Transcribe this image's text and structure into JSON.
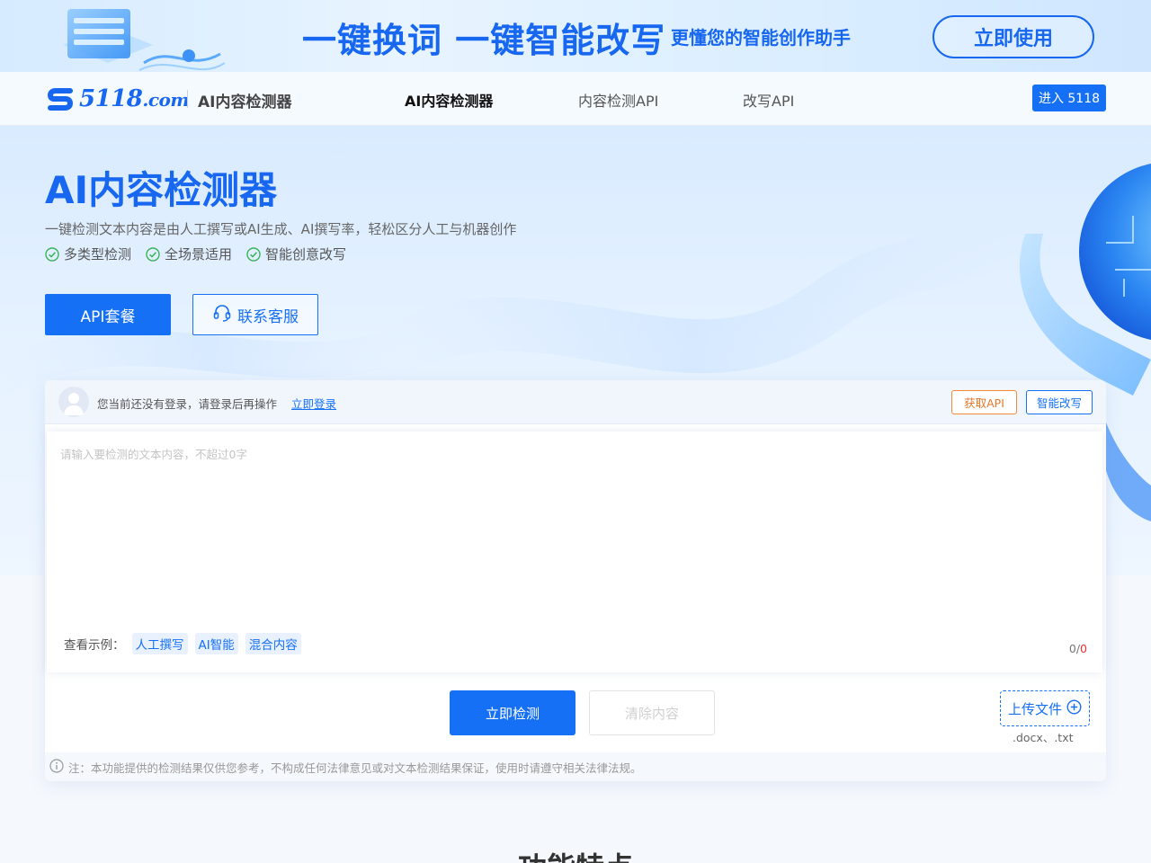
{
  "banner": {
    "title": "一键换词 一键智能改写",
    "subtitle": "更懂您的智能创作助手",
    "cta": "立即使用"
  },
  "nav": {
    "logo_text": "5118",
    "logo_domain": ".com",
    "product_name": "AI内容检测器",
    "links": [
      "AI内容检测器",
      "内容检测API",
      "改写API"
    ],
    "active_link": "AI内容检测器",
    "enter_button": "进入 5118"
  },
  "hero": {
    "title": "AI内容检测器",
    "description": "一键检测文本内容是由人工撰写或AI生成、AI撰写率，轻松区分人工与机器创作",
    "features": [
      "多类型检测",
      "全场景适用",
      "智能创意改写"
    ],
    "primary_button": "API套餐",
    "secondary_button": "联系客服"
  },
  "detector": {
    "login_tip": "您当前还没有登录，请登录后再操作",
    "login_link": "立即登录",
    "get_api_button": "获取API",
    "rewrite_button": "智能改写",
    "input_placeholder": "请输入要检测的文本内容，不超过0字",
    "examples_label": "查看示例：",
    "examples": [
      "人工撰写",
      "AI智能",
      "混合内容"
    ],
    "count_current": "0/",
    "count_max": "0",
    "detect_button": "立即检测",
    "clear_button": "清除内容",
    "upload_button": "上传文件",
    "upload_formats": ".docx、.txt",
    "note": "注：本功能提供的检测结果仅供您参考，不构成任何法律意见或对文本检测结果保证，使用时请遵守相关法律法规。"
  },
  "section": {
    "title": "功能特点"
  },
  "colors": {
    "brand": "#1670f5",
    "accent_orange": "#e6762a",
    "counter_red": "#e33333"
  }
}
